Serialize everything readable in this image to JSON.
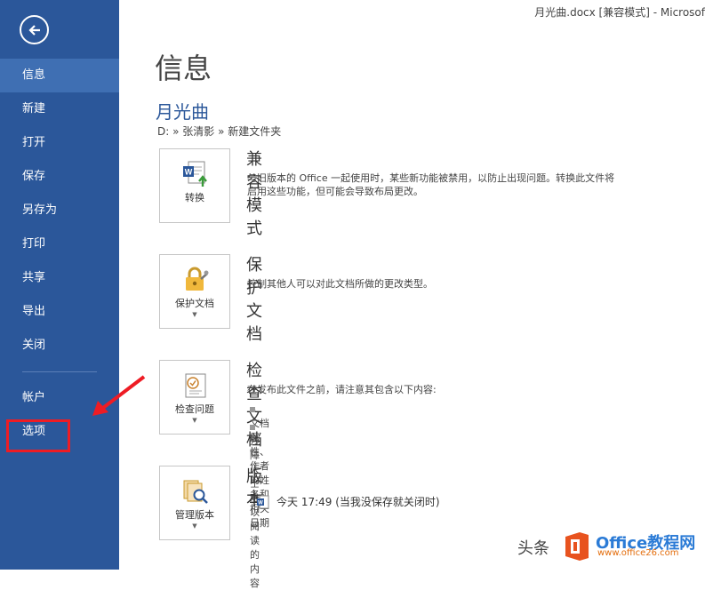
{
  "window": {
    "title": "月光曲.docx [兼容模式] - Microsof"
  },
  "sidebar": {
    "items": [
      {
        "label": "信息",
        "active": true
      },
      {
        "label": "新建"
      },
      {
        "label": "打开"
      },
      {
        "label": "保存"
      },
      {
        "label": "另存为"
      },
      {
        "label": "打印"
      },
      {
        "label": "共享"
      },
      {
        "label": "导出"
      },
      {
        "label": "关闭"
      }
    ],
    "bottom_items": [
      {
        "label": "帐户"
      },
      {
        "label": "选项"
      }
    ]
  },
  "main": {
    "title": "信息",
    "file_name": "月光曲",
    "path": "D: » 张清影 » 新建文件夹",
    "sections": {
      "compat": {
        "button": "转换",
        "heading": "兼容模式",
        "desc_line1": "与旧版本的 Office 一起使用时，某些新功能被禁用，以防止出现问题。转换此文件将",
        "desc_line2": "启用这些功能，但可能会导致布局更改。"
      },
      "protect": {
        "button": "保护文档",
        "heading": "保护文档",
        "desc": "控制其他人可以对此文档所做的更改类型。"
      },
      "inspect": {
        "button": "检查问题",
        "heading": "检查文档",
        "desc": "在发布此文件之前，请注意其包含以下内容:",
        "bullets": [
          "文档属性、作者的姓名和相关日期",
          "残障人士难以阅读的内容"
        ]
      },
      "versions": {
        "button": "管理版本",
        "heading": "版本",
        "entry": "今天 17:49 (当我没保存就关闭时)"
      }
    }
  },
  "watermark": {
    "text": "头条",
    "brand": "Office教程网",
    "url": "www.office26.com"
  },
  "colors": {
    "sidebar": "#2b579a",
    "active": "#3f6fb3",
    "highlight": "#ee1c24"
  }
}
